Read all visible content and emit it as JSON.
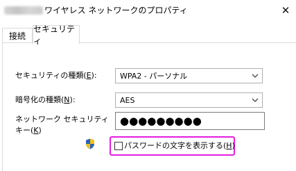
{
  "window": {
    "title": "ワイヤレス ネットワークのプロパティ",
    "close_glyph": "✕"
  },
  "tabs": [
    {
      "label": "接続",
      "active": false
    },
    {
      "label": "セキュリティ",
      "active": true
    }
  ],
  "security_type": {
    "label": "セキュリティの種類",
    "hotkey": "E",
    "value": "WPA2 - パーソナル"
  },
  "encryption_type": {
    "label": "暗号化の種類",
    "hotkey": "N",
    "value": "AES"
  },
  "network_key": {
    "label_line1": "ネットワーク セキュリティ",
    "label_line2": "キー",
    "hotkey": "K",
    "masked_value": "●●●●●●●●●"
  },
  "show_characters": {
    "label": "パスワードの文字を表示する",
    "hotkey": "H",
    "checked": false
  },
  "colors": {
    "highlight": "#e31ee0",
    "shield_blue": "#2a62b8",
    "shield_yellow": "#f2c21b"
  }
}
